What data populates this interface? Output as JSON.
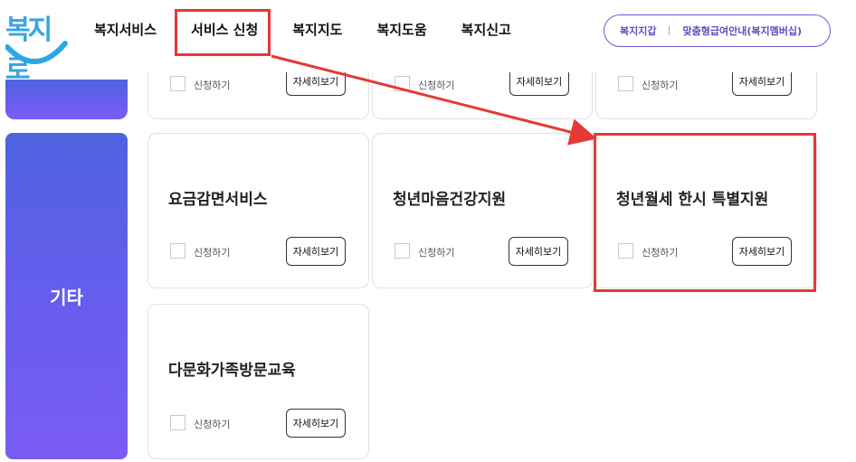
{
  "logo": {
    "text": "복지로"
  },
  "nav": {
    "items": [
      {
        "label": "복지서비스",
        "name": "nav-welfare-services"
      },
      {
        "label": "서비스 신청",
        "name": "nav-service-apply"
      },
      {
        "label": "복지지도",
        "name": "nav-welfare-map"
      },
      {
        "label": "복지도움",
        "name": "nav-welfare-help"
      },
      {
        "label": "복지신고",
        "name": "nav-welfare-report"
      }
    ]
  },
  "util": {
    "wallet": "복지지갑",
    "guide": "맞춤형급여안내(복지멤버십)"
  },
  "categories": {
    "etc": "기타"
  },
  "common": {
    "apply_label": "신청하기",
    "detail_label": "자세히보기"
  },
  "cards": {
    "c1": {
      "title": "요금감면서비스"
    },
    "c2": {
      "title": "청년마음건강지원"
    },
    "c3": {
      "title": "청년월세 한시 특별지원"
    },
    "c4": {
      "title": "다문화가족방문교육"
    }
  },
  "colors": {
    "accent": "#5b4ec2",
    "category_gradient_top": "#4e63e0",
    "category_gradient_bottom": "#7a5cf3",
    "highlight": "#e53935"
  }
}
